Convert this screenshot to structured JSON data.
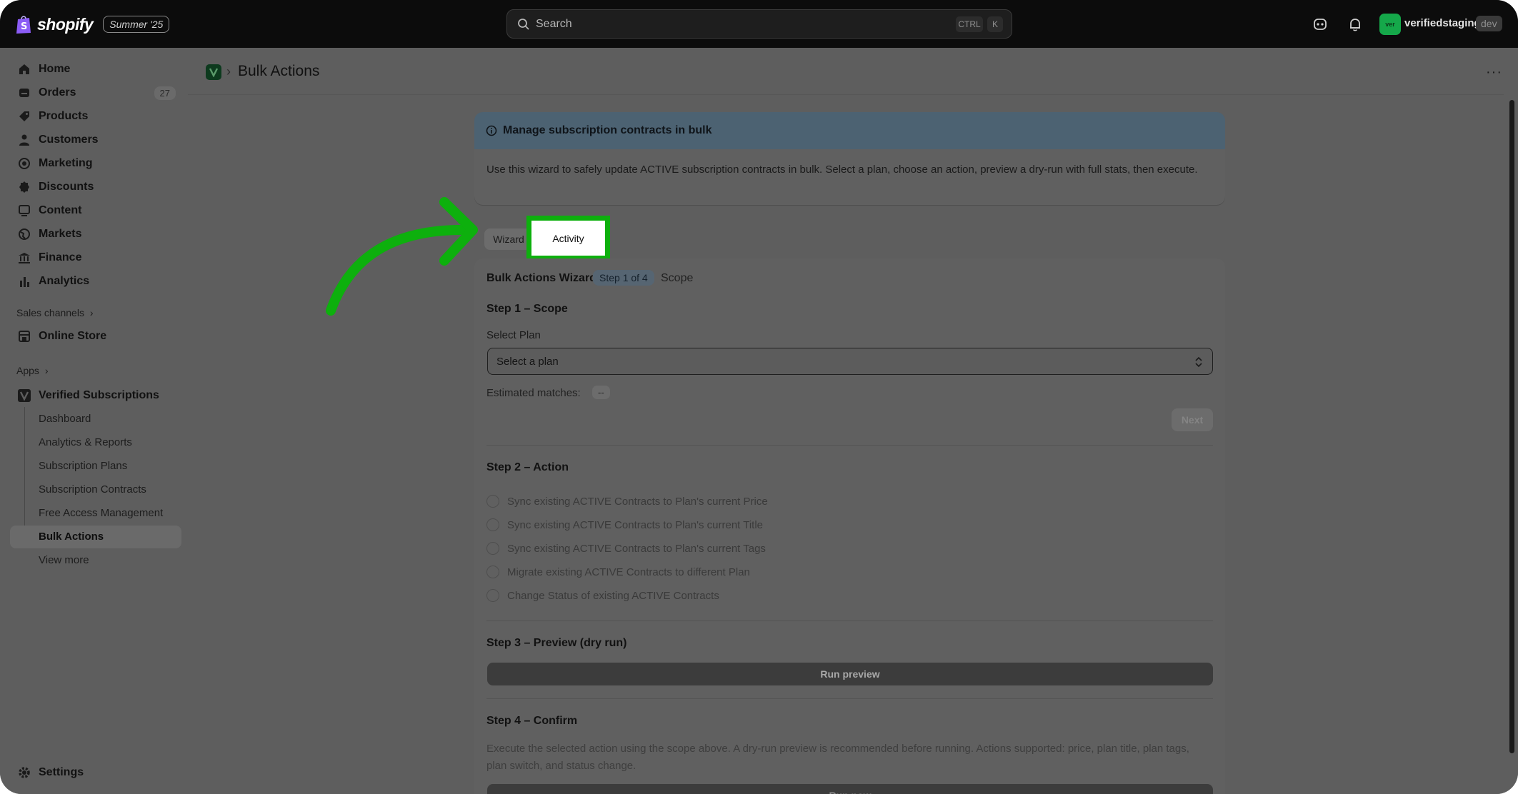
{
  "topbar": {
    "brand": "shopify",
    "edition_badge": "Summer '25",
    "search_placeholder": "Search",
    "shortcut_ctrl": "CTRL",
    "shortcut_key": "K",
    "store_initials": "ver",
    "store_name": "verifiedstaging",
    "store_env": "dev"
  },
  "sidebar": {
    "items": [
      {
        "label": "Home",
        "icon": "home-icon"
      },
      {
        "label": "Orders",
        "icon": "orders-icon",
        "count": "27"
      },
      {
        "label": "Products",
        "icon": "tag-icon"
      },
      {
        "label": "Customers",
        "icon": "person-icon"
      },
      {
        "label": "Marketing",
        "icon": "target-icon"
      },
      {
        "label": "Discounts",
        "icon": "discount-icon"
      },
      {
        "label": "Content",
        "icon": "content-icon"
      },
      {
        "label": "Markets",
        "icon": "globe-icon"
      },
      {
        "label": "Finance",
        "icon": "bank-icon"
      },
      {
        "label": "Analytics",
        "icon": "bar-chart-icon"
      }
    ],
    "sales_channels_label": "Sales channels",
    "online_store": "Online Store",
    "apps_label": "Apps",
    "app_name": "Verified Subscriptions",
    "app_pages": [
      "Dashboard",
      "Analytics & Reports",
      "Subscription Plans",
      "Subscription Contracts",
      "Free Access Management",
      "Bulk Actions",
      "View more"
    ],
    "settings": "Settings"
  },
  "header": {
    "breadcrumb_sep": "›",
    "title": "Bulk Actions",
    "more": "···"
  },
  "banner": {
    "title": "Manage subscription contracts in bulk",
    "body": "Use this wizard to safely update ACTIVE subscription contracts in bulk. Select a plan, choose an action, preview a dry-run with full stats, then execute."
  },
  "tabs": {
    "wizard": "Wizard",
    "activity": "Activity"
  },
  "wizard": {
    "title": "Bulk Actions Wizard",
    "step_pill": "Step 1 of 4",
    "step_name": "Scope",
    "step1": {
      "heading": "Step 1 – Scope",
      "select_label": "Select Plan",
      "select_value": "Select a plan",
      "estimated_label": "Estimated matches:",
      "estimated_value": "--",
      "next": "Next"
    },
    "step2": {
      "heading": "Step 2 – Action",
      "options": [
        "Sync existing ACTIVE Contracts to Plan's current Price",
        "Sync existing ACTIVE Contracts to Plan's current Title",
        "Sync existing ACTIVE Contracts to Plan's current Tags",
        "Migrate existing ACTIVE Contracts to different Plan",
        "Change Status of existing ACTIVE Contracts"
      ]
    },
    "step3": {
      "heading": "Step 3 – Preview (dry run)",
      "button": "Run preview"
    },
    "step4": {
      "heading": "Step 4 – Confirm",
      "text": "Execute the selected action using the scope above. A dry-run preview is recommended before running. Actions supported: price, plan title, plan tags, plan switch, and status change.",
      "button": "Run now"
    }
  },
  "colors": {
    "highlight": "#0db00d",
    "topbar": "#0c0c0c",
    "overlay": "#5e5e5e"
  }
}
